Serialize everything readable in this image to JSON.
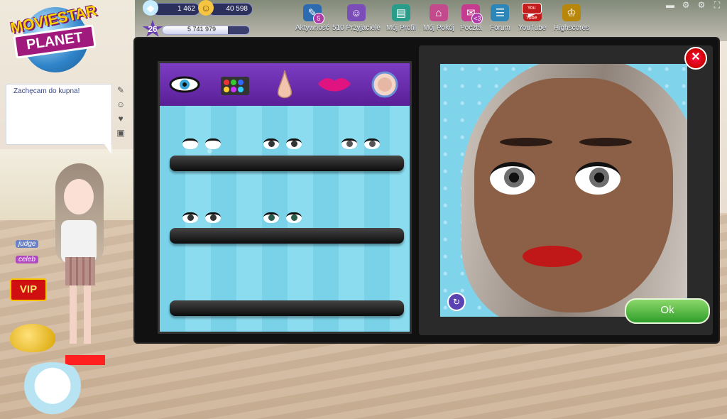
{
  "logo": {
    "line1": "MOVIESTAR",
    "line2": "PLANET"
  },
  "stats": {
    "diamonds": "1 462",
    "starcoins": "40 598",
    "level": "26",
    "fame": "5 741 979",
    "fame_progress_percent": 75
  },
  "nav": [
    {
      "label": "Aktywność",
      "icon": "activity-icon",
      "badge": "5"
    },
    {
      "label": "510 Przyjaciele",
      "icon": "friends-icon"
    },
    {
      "label": "Mój Profil",
      "icon": "profile-icon"
    },
    {
      "label": "Mój Pokój",
      "icon": "room-icon"
    },
    {
      "label": "Poczta",
      "icon": "mail-icon",
      "badge": "<3"
    },
    {
      "label": "Forum",
      "icon": "forum-icon"
    },
    {
      "label": "YouTube",
      "icon": "youtube-icon",
      "badge": "You Tube"
    },
    {
      "label": "Highscores",
      "icon": "trophy-icon"
    }
  ],
  "chat": {
    "message": "Zachęcam do kupna!"
  },
  "avatar": {
    "tags": [
      "judge",
      "celeb"
    ],
    "vip": "VIP"
  },
  "editor": {
    "tabs": [
      "eyes-tab",
      "eyeshadow-tab",
      "nose-tab",
      "mouth-tab",
      "skin-tab"
    ],
    "ok_label": "Ok",
    "close_label": "✕"
  },
  "colors": {
    "accent_purple": "#6a2fb0",
    "ok_green": "#3aa52f",
    "close_red": "#d40e1c"
  }
}
